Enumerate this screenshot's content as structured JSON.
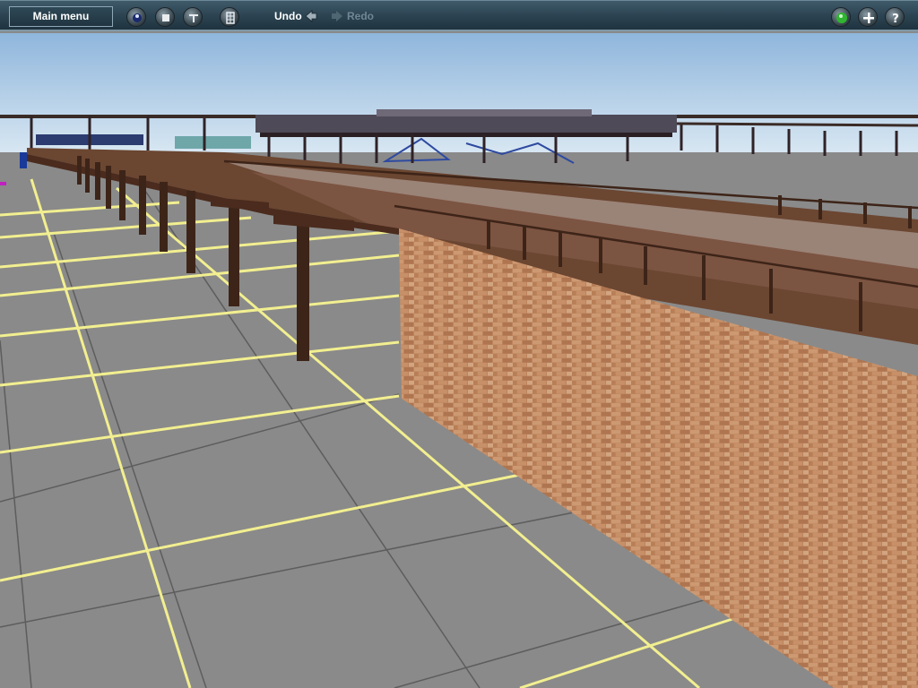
{
  "toolbar": {
    "main_menu_label": "Main menu",
    "undo_label": "Undo",
    "redo_label": "Redo",
    "left_icons": [
      "layers-icon",
      "stop-icon",
      "brush-icon",
      "grid-icon"
    ],
    "right_icons": [
      "status-green-icon",
      "add-icon",
      "help-icon"
    ]
  },
  "colors": {
    "toolbar_bg": "#2b4250",
    "ground": "#8a8a8a",
    "grid_lines": "#f2ef90",
    "brick": "#c98d62",
    "timber": "#5a3220",
    "sky": "#cfe3f3",
    "disabled_text": "#6f8795"
  }
}
